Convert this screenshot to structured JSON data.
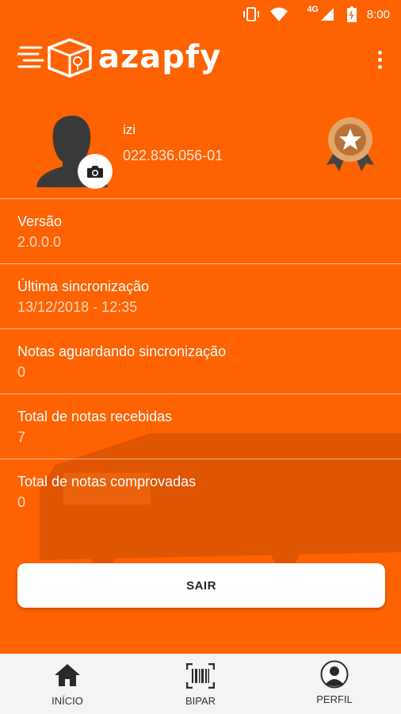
{
  "status_bar": {
    "time": "8:00",
    "network": "4G"
  },
  "app": {
    "logo_text": "azapfy"
  },
  "profile": {
    "name": "izi",
    "document": "022.836.056-01"
  },
  "info_rows": [
    {
      "label": "Versão",
      "value": "2.0.0.0"
    },
    {
      "label": "Última sincronização",
      "value": "13/12/2018 - 12:35"
    },
    {
      "label": "Notas aguardando sincronização",
      "value": "0"
    },
    {
      "label": "Total de notas recebidas",
      "value": "7"
    },
    {
      "label": "Total de notas comprovadas",
      "value": "0"
    }
  ],
  "actions": {
    "logout_label": "SAIR"
  },
  "bottom_nav": [
    {
      "label": "INÍCIO",
      "icon": "home-icon"
    },
    {
      "label": "BIPAR",
      "icon": "barcode-icon"
    },
    {
      "label": "PERFIL",
      "icon": "profile-icon"
    }
  ],
  "colors": {
    "primary": "#ff6200",
    "nav_bg": "#f4f4f4",
    "medal": "#c8894a"
  }
}
